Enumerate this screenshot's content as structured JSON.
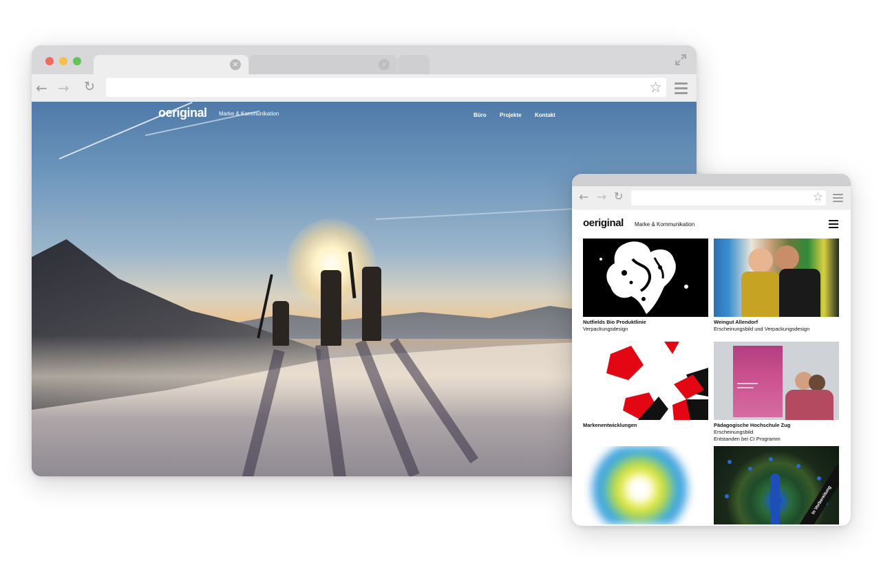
{
  "desktop": {
    "site": {
      "logo": "oeriginal",
      "tagline": "Marke & Kommunikation",
      "nav": [
        "Büro",
        "Projekte",
        "Kontakt"
      ]
    },
    "hero": {
      "image": "mountaineers-hiking-snowy-ridge-at-sunset"
    }
  },
  "mobile": {
    "site": {
      "logo": "oeriginal",
      "tagline": "Marke & Kommunikation",
      "menu_icon": "hamburger-icon"
    },
    "projects": [
      {
        "title": "Nutfields Bio Produktlinie",
        "subtitle": "Verpackungsdesign",
        "extra": ""
      },
      {
        "title": "Weingut Allendorf",
        "subtitle": "Erscheinungsbild und Verpackungsdesign",
        "extra": ""
      },
      {
        "title": "Markenentwicklungen",
        "subtitle": "",
        "extra": ""
      },
      {
        "title": "Pädagogische Hochschule Zug",
        "subtitle": "Erscheinungsbild",
        "extra": "Entstanden bei CI Programm"
      },
      {
        "title": "",
        "subtitle": "",
        "extra": ""
      },
      {
        "title": "",
        "subtitle": "",
        "extra": "",
        "badge": "In Vorbereitung"
      }
    ]
  },
  "colors": {
    "chrome": "#d8d8da",
    "toolbar": "#eeeeef",
    "close": "#ee6a5f",
    "minimize": "#f5be4f",
    "maximize": "#62c554",
    "accent_red": "#e30613"
  }
}
